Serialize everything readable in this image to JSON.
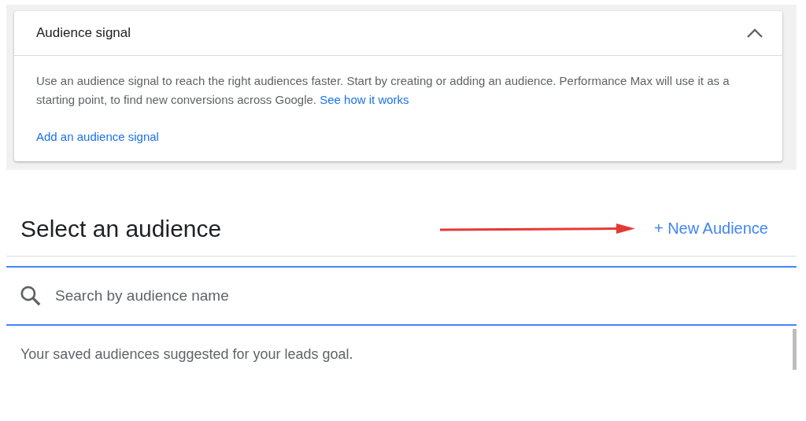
{
  "audience_signal_card": {
    "title": "Audience signal",
    "expanded": true,
    "description": "Use an audience signal to reach the right audiences faster. Start by creating or adding an audience. Performance Max will use it as a starting point, to find new conversions across Google.",
    "description_link": "See how it works",
    "action_link": "Add an audience signal"
  },
  "select_audience": {
    "title": "Select an audience",
    "new_button": "+ New Audience",
    "search": {
      "placeholder": "Search by audience name"
    },
    "hint": "Your saved audiences suggested for your leads goal."
  }
}
